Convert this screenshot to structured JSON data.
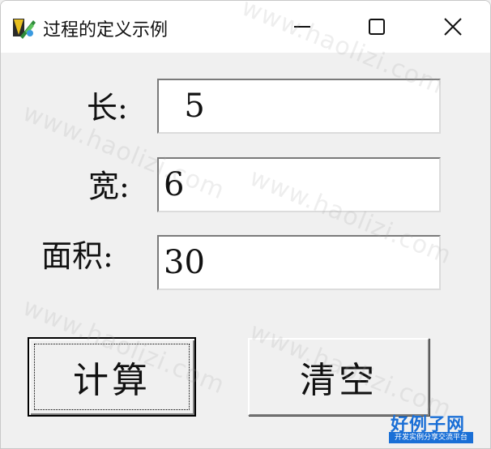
{
  "window": {
    "title": "过程的定义示例",
    "icon": "vb-app-icon",
    "controls": [
      "minimize-icon",
      "maximize-icon",
      "close-icon"
    ]
  },
  "form": {
    "length_label": "长:",
    "length_value": "  5",
    "width_label": "宽:",
    "width_value": "6",
    "area_label": "面积:",
    "area_value": "30"
  },
  "buttons": {
    "calc_label": "计算",
    "clear_label": "清空"
  },
  "watermark": "www.haolizi.com",
  "logo": {
    "main": "好例子网",
    "sub": "开发实例分享交流平台"
  }
}
